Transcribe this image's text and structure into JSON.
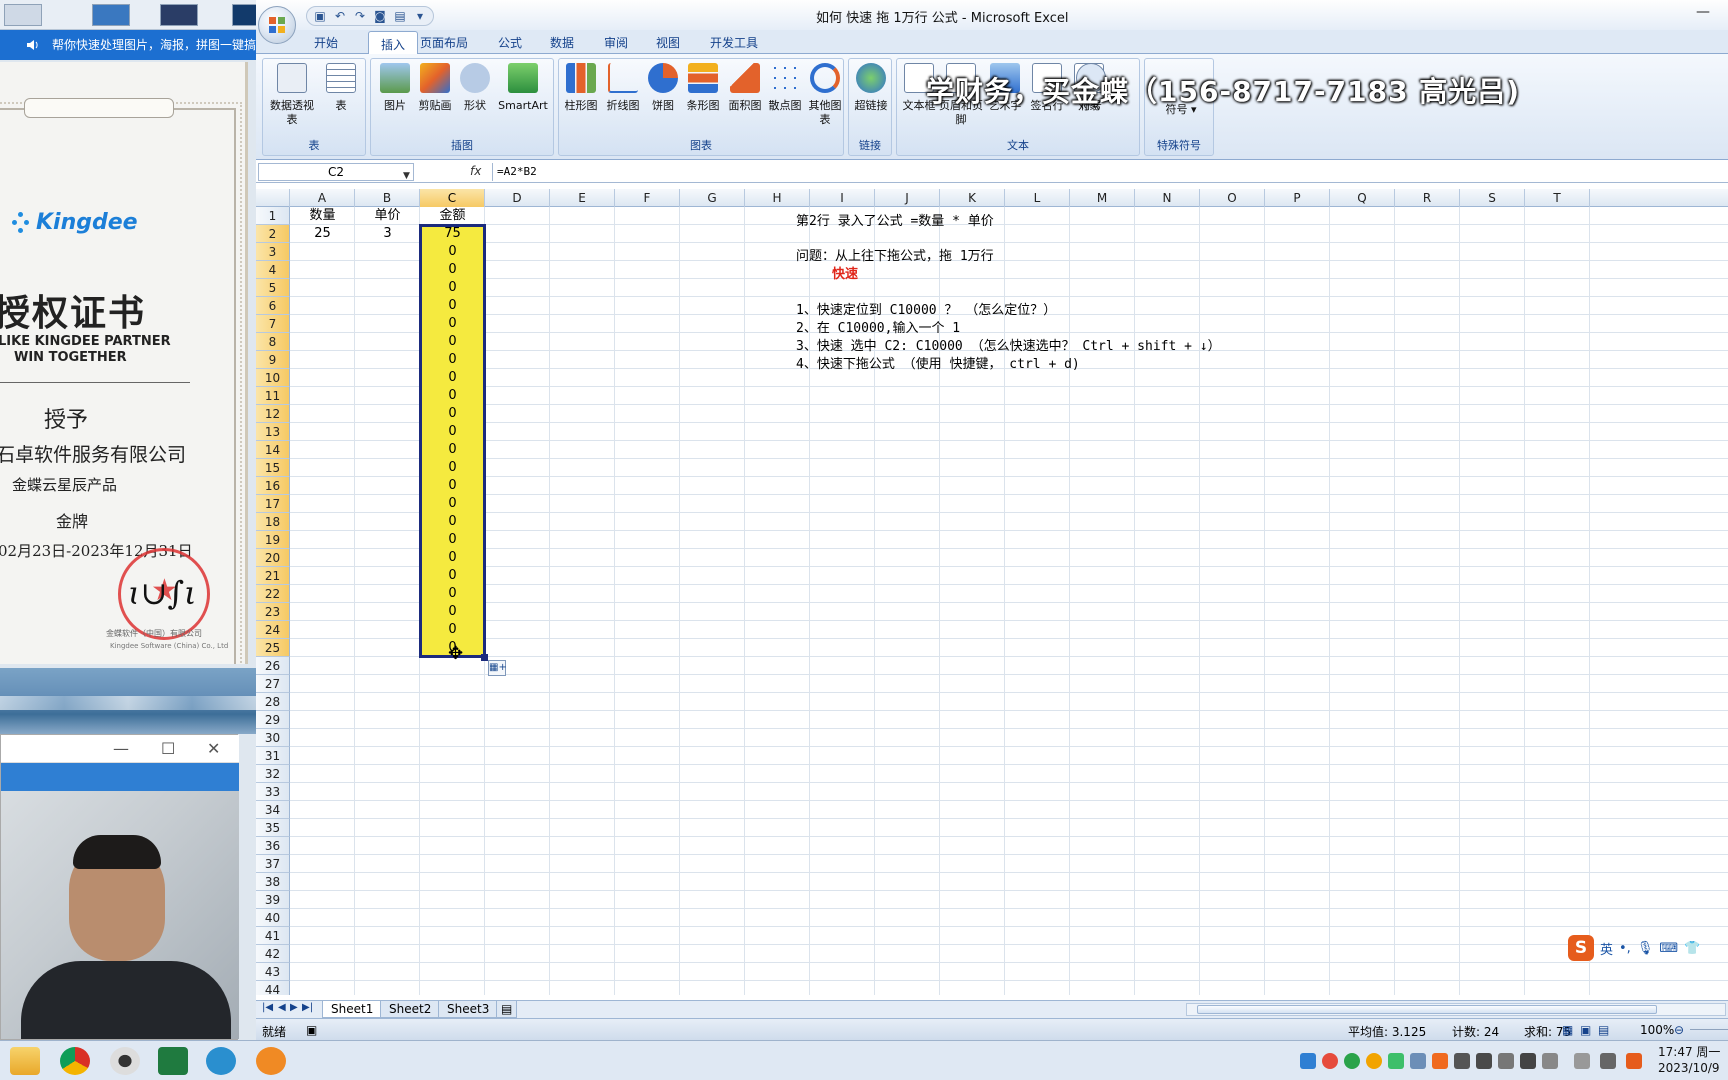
{
  "left_panel": {
    "notice": "帮你快速处理图片，海报，拼图一键搞",
    "certificate": {
      "brand": "Kingdee",
      "title": "授权证书",
      "slogan_1": "LIKE KINGDEE PARTNER",
      "slogan_2": "WIN TOGETHER",
      "grant": "授予",
      "company": "石卓软件服务有限公司",
      "product": "金蝶云星辰产品",
      "level": "金牌",
      "date_range": "02月23日-2023年12月31日",
      "footer_1": "金蝶软件（中国）有限公司",
      "footer_2": "Kingdee Software (China) Co., Ltd"
    },
    "mini_window_controls": {
      "minimize": "—",
      "maximize": "☐",
      "close": "✕"
    }
  },
  "excel": {
    "window_title": "如何 快速 拖 1万行  公式 - Microsoft Excel",
    "ribbon_tabs": [
      "开始",
      "插入",
      "页面布局",
      "公式",
      "数据",
      "审阅",
      "视图",
      "开发工具"
    ],
    "active_tab": "插入",
    "ribbon_groups": {
      "table": {
        "label": "表",
        "buttons": [
          "数据透视表",
          "表"
        ]
      },
      "illustrations": {
        "label": "插图",
        "buttons": [
          "图片",
          "剪贴画",
          "形状",
          "SmartArt"
        ]
      },
      "charts": {
        "label": "图表",
        "buttons": [
          "柱形图",
          "折线图",
          "饼图",
          "条形图",
          "面积图",
          "散点图",
          "其他图表"
        ]
      },
      "links": {
        "label": "链接",
        "buttons": [
          "超链接"
        ]
      },
      "text": {
        "label": "文本",
        "buttons": [
          "文本框",
          "页眉和页脚",
          "艺术字",
          "签名行",
          "对象"
        ]
      },
      "symbols": {
        "label": "特殊符号",
        "buttons": [
          "符号",
          "符号"
        ]
      }
    },
    "watermark": "学财务，买金蝶（156-8717-7183 高光吕)",
    "name_box": "C2",
    "formula": "=A2*B2",
    "columns": [
      "A",
      "B",
      "C",
      "D",
      "E",
      "F",
      "G",
      "H",
      "I",
      "J",
      "K",
      "L",
      "M",
      "N",
      "O",
      "P",
      "Q",
      "R",
      "S",
      "T"
    ],
    "selected_column": "C",
    "headers_row": {
      "A": "数量",
      "B": "单价",
      "C": "金额"
    },
    "row2": {
      "A": "25",
      "B": "3",
      "C": "75"
    },
    "c_values": [
      "0",
      "0",
      "0",
      "0",
      "0",
      "0",
      "0",
      "0",
      "0",
      "0",
      "0",
      "0",
      "0",
      "0",
      "0",
      "0",
      "0",
      "0",
      "0",
      "0",
      "0",
      "0",
      "0"
    ],
    "row_count": 44,
    "notes": {
      "line1": "第2行 录入了公式 =数量 * 单价",
      "line2": "问题：从上往下拖公式，拖 1万行",
      "emphasis": "快速",
      "step1": "1、快速定位到 C10000  ？ （怎么定位？）",
      "step2": "2、在 C10000,输入一个  1",
      "step3": "3、快速 选中 C2: C10000   （怎么快速选中？  Ctrl +  shift + ↓）",
      "step4": "4、快速下拖公式 （使用 快捷键， ctrl + d)"
    },
    "sheet_tabs": [
      "Sheet1",
      "Sheet2",
      "Sheet3"
    ],
    "active_sheet": "Sheet1",
    "status": {
      "mode": "就绪",
      "average": "平均值: 3.125",
      "count": "计数: 24",
      "sum": "求和: 75",
      "zoom": "100%"
    }
  },
  "ime": {
    "logo": "S",
    "lang": "英",
    "punct": "•,"
  },
  "clock": {
    "time": "17:47 周一",
    "date": "2023/10/9"
  },
  "colors": {
    "selection_fill": "#f5ea3f",
    "selection_border": "#1b2b7d",
    "emphasis_red": "#e0261a"
  }
}
